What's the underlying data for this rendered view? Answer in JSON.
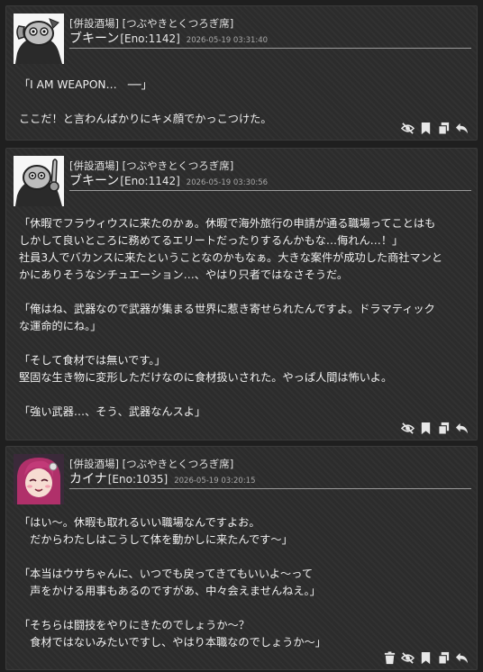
{
  "posts": [
    {
      "location": "[併設酒場] [つぶやきとくつろぎ席]",
      "name": "ブキーン",
      "eno": "[Eno:1142]",
      "time": "2026-05-19 03:31:40",
      "lines": [
        "「I AM WEAPON…　──」",
        "",
        "ここだ！と言わんばかりにキメ顔でかっこつけた。"
      ],
      "actions": [
        "hide-icon",
        "bookmark-icon",
        "copy-icon",
        "reply-icon"
      ]
    },
    {
      "location": "[併設酒場] [つぶやきとくつろぎ席]",
      "name": "ブキーン",
      "eno": "[Eno:1142]",
      "time": "2026-05-19 03:30:56",
      "lines": [
        "「休暇でフラウィウスに来たのかぁ。休暇で海外旅行の申請が通る職場ってことはも",
        "しかして良いところに務めてるエリートだったりするんかもな…侮れん…！」",
        "社員3人でバカンスに来たということなのかもなぁ。大きな案件が成功した商社マンと",
        "かにありそうなシチュエーション…、やはり只者ではなさそうだ。",
        "",
        "「俺はね、武器なので武器が集まる世界に惹き寄せられたんですよ。ドラマティック",
        "な運命的にね。」",
        "",
        "「そして食材では無いです。」",
        "堅固な生き物に変形しただけなのに食材扱いされた。やっぱ人間は怖いよ。",
        "",
        "「強い武器…、そう、武器なんスよ」"
      ],
      "actions": [
        "hide-icon",
        "bookmark-icon",
        "copy-icon",
        "reply-icon"
      ]
    },
    {
      "location": "[併設酒場] [つぶやきとくつろぎ席]",
      "name": "カイナ",
      "eno": "[Eno:1035]",
      "time": "2026-05-19 03:20:15",
      "lines": [
        "「はい〜。休暇も取れるいい職場なんですよお。",
        "　だからわたしはこうして体を動かしに来たんです〜」",
        "",
        "「本当はウサちゃんに、いつでも戻ってきてもいいよ〜って",
        "　声をかける用事もあるのですがあ、中々会えませんねえ。」",
        "",
        "「そちらは闘技をやりにきたのでしょうか〜？",
        "　食材ではないみたいですし、やはり本職なのでしょうか〜」"
      ],
      "actions": [
        "trash-icon",
        "hide-icon",
        "bookmark-icon",
        "copy-icon",
        "reply-icon"
      ]
    }
  ]
}
